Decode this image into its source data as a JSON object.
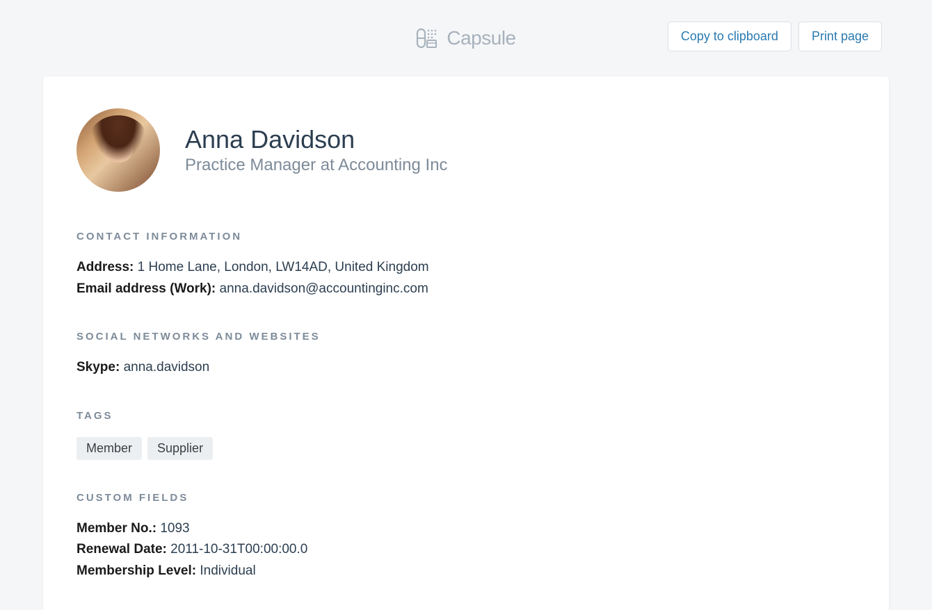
{
  "app": {
    "name": "Capsule"
  },
  "actions": {
    "copy_label": "Copy to clipboard",
    "print_label": "Print page"
  },
  "person": {
    "name": "Anna Davidson",
    "subtitle": "Practice Manager at Accounting Inc"
  },
  "sections": {
    "contact": {
      "heading": "CONTACT INFORMATION",
      "address_label": "Address:",
      "address_value": "1 Home Lane, London, LW14AD, United Kingdom",
      "email_label": "Email address (Work):",
      "email_value": "anna.davidson@accountinginc.com"
    },
    "social": {
      "heading": "SOCIAL NETWORKS AND WEBSITES",
      "skype_label": "Skype:",
      "skype_value": "anna.davidson"
    },
    "tags": {
      "heading": "TAGS",
      "items": [
        "Member",
        "Supplier"
      ]
    },
    "custom": {
      "heading": "CUSTOM FIELDS",
      "member_no_label": "Member No.:",
      "member_no_value": "1093",
      "renewal_label": "Renewal Date:",
      "renewal_value": "2011-10-31T00:00:00.0",
      "membership_label": "Membership Level:",
      "membership_value": "Individual"
    }
  }
}
